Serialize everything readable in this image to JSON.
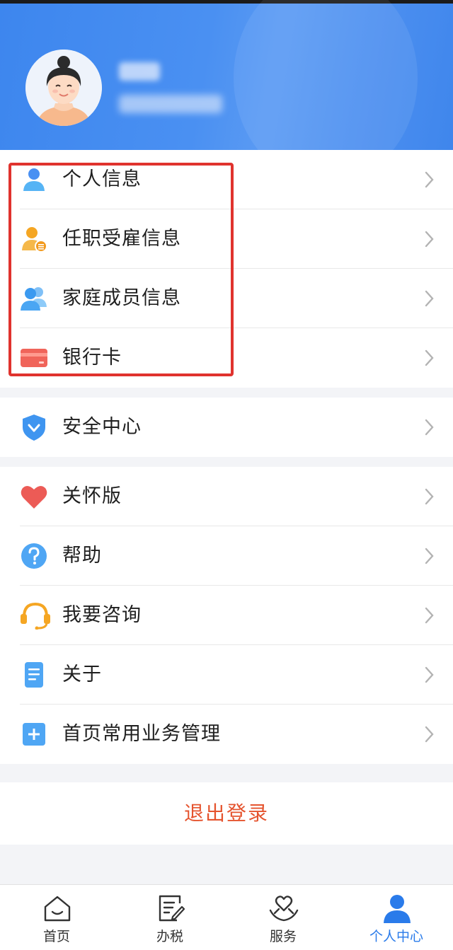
{
  "header": {
    "avatar_icon": "avatar-woman",
    "username_blurred": "",
    "subtitle_blurred": ""
  },
  "groups": [
    {
      "items": [
        {
          "label": "个人信息",
          "icon": "person-icon"
        },
        {
          "label": "任职受雇信息",
          "icon": "employment-icon"
        },
        {
          "label": "家庭成员信息",
          "icon": "family-icon"
        },
        {
          "label": "银行卡",
          "icon": "bank-card-icon"
        }
      ]
    },
    {
      "items": [
        {
          "label": "安全中心",
          "icon": "shield-icon"
        }
      ]
    },
    {
      "items": [
        {
          "label": "关怀版",
          "icon": "heart-icon"
        },
        {
          "label": "帮助",
          "icon": "question-icon"
        },
        {
          "label": "我要咨询",
          "icon": "headset-icon"
        },
        {
          "label": "关于",
          "icon": "document-icon"
        },
        {
          "label": "首页常用业务管理",
          "icon": "plus-square-icon"
        }
      ]
    }
  ],
  "logout": {
    "label": "退出登录"
  },
  "tabbar": {
    "tabs": [
      {
        "label": "首页",
        "icon": "home-icon"
      },
      {
        "label": "办税",
        "icon": "edit-icon"
      },
      {
        "label": "服务",
        "icon": "heart-hand-icon"
      },
      {
        "label": "个人中心",
        "icon": "user-icon",
        "active": true
      }
    ]
  },
  "colors": {
    "header_blue": "#4a90f2",
    "highlight_red": "#e0332e",
    "logout_red": "#e5542f",
    "active_blue": "#2a7bea"
  }
}
